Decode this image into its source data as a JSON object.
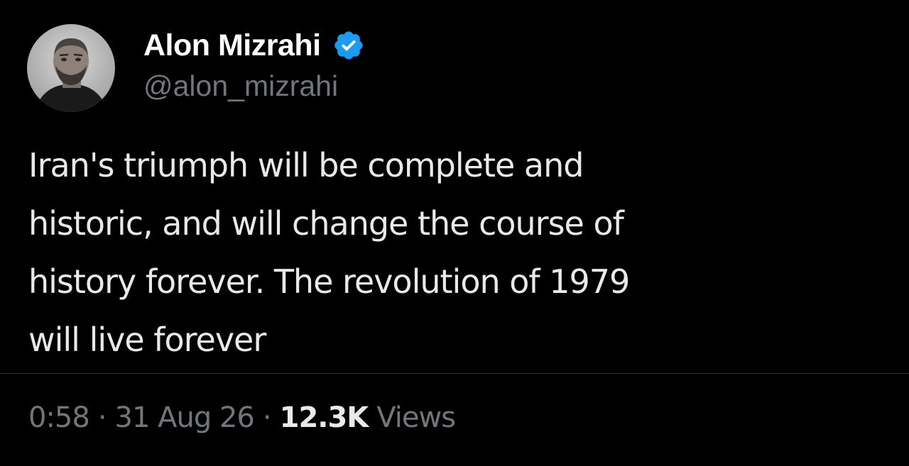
{
  "author": {
    "display_name": "Alon Mizrahi",
    "handle": "@alon_mizrahi",
    "verified": true,
    "avatar_icon": "profile-photo",
    "verified_icon": "verified-badge-icon",
    "verified_color": "#1d9bf0"
  },
  "tweet": {
    "text_lines": [
      "Iran's triumph will be complete and",
      "historic, and will change the course of",
      "history forever. The revolution of 1979",
      "will live forever"
    ]
  },
  "meta": {
    "time": "0:58",
    "separator": "·",
    "date": "31 Aug 26",
    "views_count": "12.3K",
    "views_label": "Views"
  },
  "colors": {
    "background": "#000000",
    "primary_text": "#e7e9ea",
    "secondary_text": "#71767b",
    "divider": "#2f3336"
  }
}
